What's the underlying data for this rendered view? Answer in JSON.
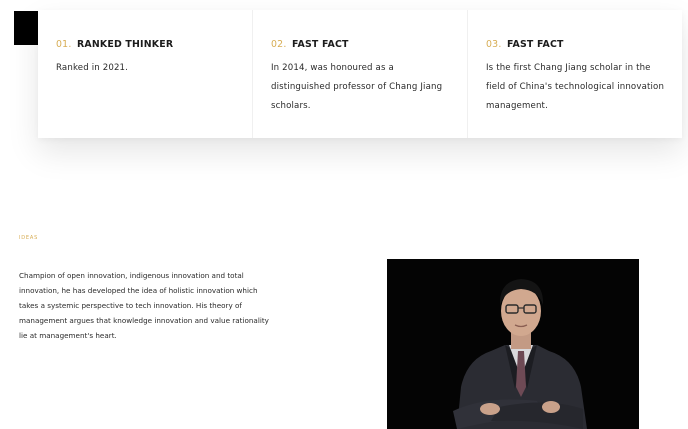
{
  "facts": [
    {
      "num": "01.",
      "title": "RANKED THINKER",
      "body": "Ranked in 2021."
    },
    {
      "num": "02.",
      "title": "FAST FACT",
      "body": "In 2014, was honoured as a distinguished professor of Chang Jiang scholars."
    },
    {
      "num": "03.",
      "title": "FAST FACT",
      "body": "Is the first Chang Jiang scholar in the field of China's technological innovation management."
    }
  ],
  "ideas": {
    "label": "IDEAS",
    "text": "Champion of open innovation, indigenous innovation and total innovation, he has developed the idea of holistic innovation which takes a systemic perspective to tech innovation. His theory of management argues that knowledge innovation and value rationality lie at management's heart."
  },
  "colors": {
    "accent": "#d7ad54",
    "portrait_bg": "#040404"
  }
}
